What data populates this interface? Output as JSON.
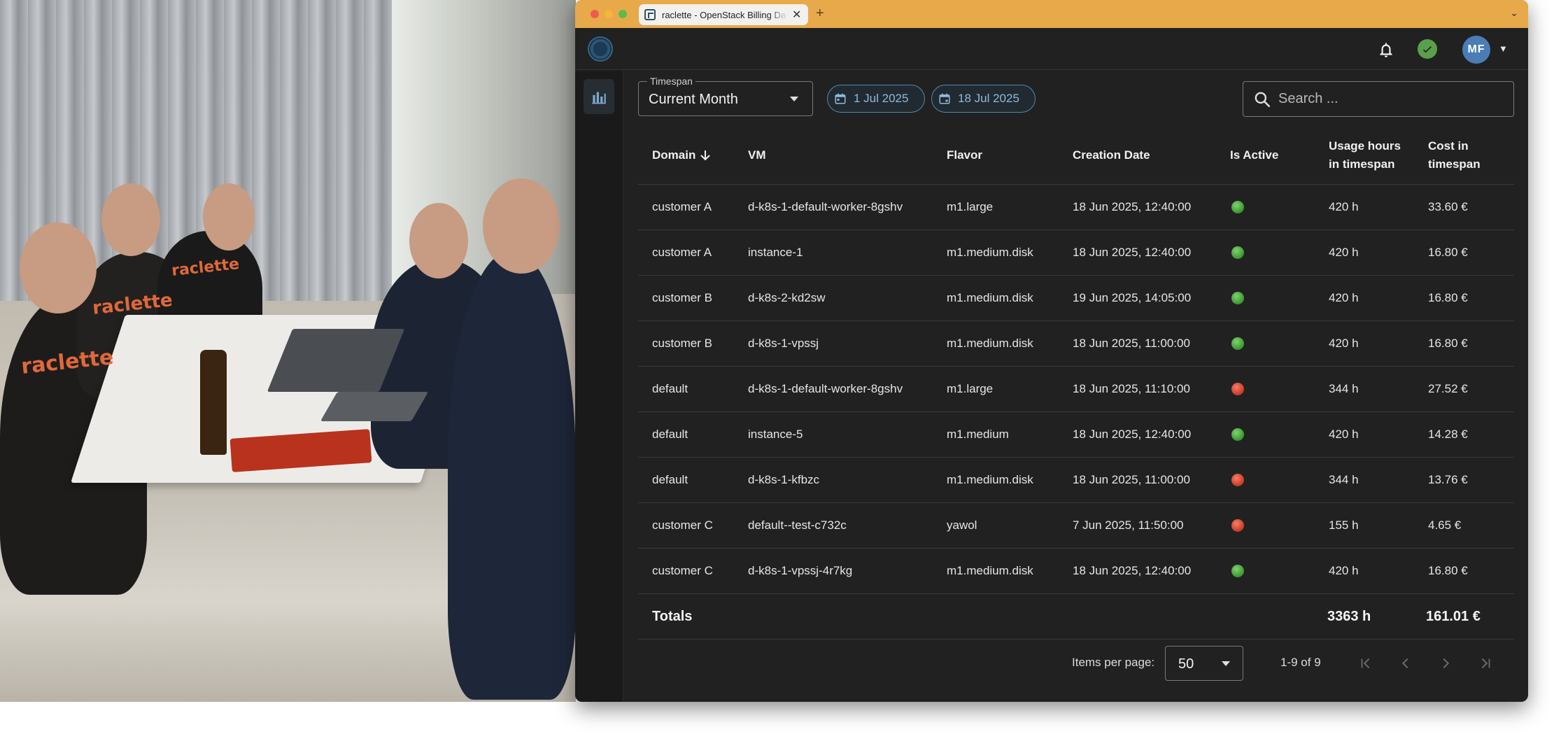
{
  "browser": {
    "tab_title": "raclette - OpenStack Billing Dashboard",
    "close_glyph": "✕",
    "new_tab_glyph": "+",
    "chevron_glyph": "⌄"
  },
  "photo": {
    "shirt_text": "raclette"
  },
  "header": {
    "avatar_initials": "MF",
    "avatar_color": "#4a7db5",
    "status_color": "#5aa04c"
  },
  "filters": {
    "timespan_label": "Timespan",
    "timespan_value": "Current Month",
    "start_date": "1 Jul 2025",
    "end_date": "18 Jul 2025",
    "search_placeholder": "Search ..."
  },
  "table": {
    "columns": {
      "domain": "Domain",
      "vm": "VM",
      "flavor": "Flavor",
      "creation_date": "Creation Date",
      "is_active": "Is Active",
      "usage": "Usage hours in timespan",
      "cost": "Cost in timespan"
    },
    "rows": [
      {
        "domain": "customer A",
        "vm": "d-k8s-1-default-worker-8gshv",
        "flavor": "m1.large",
        "created": "18 Jun 2025, 12:40:00",
        "active": true,
        "usage": "420 h",
        "cost": "33.60 €"
      },
      {
        "domain": "customer A",
        "vm": "instance-1",
        "flavor": "m1.medium.disk",
        "created": "18 Jun 2025, 12:40:00",
        "active": true,
        "usage": "420 h",
        "cost": "16.80 €"
      },
      {
        "domain": "customer B",
        "vm": "d-k8s-2-kd2sw",
        "flavor": "m1.medium.disk",
        "created": "19 Jun 2025, 14:05:00",
        "active": true,
        "usage": "420 h",
        "cost": "16.80 €"
      },
      {
        "domain": "customer B",
        "vm": "d-k8s-1-vpssj",
        "flavor": "m1.medium.disk",
        "created": "18 Jun 2025, 11:00:00",
        "active": true,
        "usage": "420 h",
        "cost": "16.80 €"
      },
      {
        "domain": "default",
        "vm": "d-k8s-1-default-worker-8gshv",
        "flavor": "m1.large",
        "created": "18 Jun 2025, 11:10:00",
        "active": false,
        "usage": "344 h",
        "cost": "27.52 €"
      },
      {
        "domain": "default",
        "vm": "instance-5",
        "flavor": "m1.medium",
        "created": "18 Jun 2025, 12:40:00",
        "active": true,
        "usage": "420 h",
        "cost": "14.28 €"
      },
      {
        "domain": "default",
        "vm": "d-k8s-1-kfbzc",
        "flavor": "m1.medium.disk",
        "created": "18 Jun 2025, 11:00:00",
        "active": false,
        "usage": "344 h",
        "cost": "13.76 €"
      },
      {
        "domain": "customer C",
        "vm": "default--test-c732c",
        "flavor": "yawol",
        "created": "7 Jun 2025, 11:50:00",
        "active": false,
        "usage": "155 h",
        "cost": "4.65 €"
      },
      {
        "domain": "customer C",
        "vm": "d-k8s-1-vpssj-4r7kg",
        "flavor": "m1.medium.disk",
        "created": "18 Jun 2025, 12:40:00",
        "active": true,
        "usage": "420 h",
        "cost": "16.80 €"
      }
    ],
    "totals": {
      "label": "Totals",
      "usage": "3363 h",
      "cost": "161.01 €"
    },
    "status_colors": {
      "active": "#3f9a34",
      "inactive": "#c4402b"
    }
  },
  "paginator": {
    "items_per_page_label": "Items per page:",
    "items_per_page_value": "50",
    "range_label": "1-9 of 9"
  }
}
